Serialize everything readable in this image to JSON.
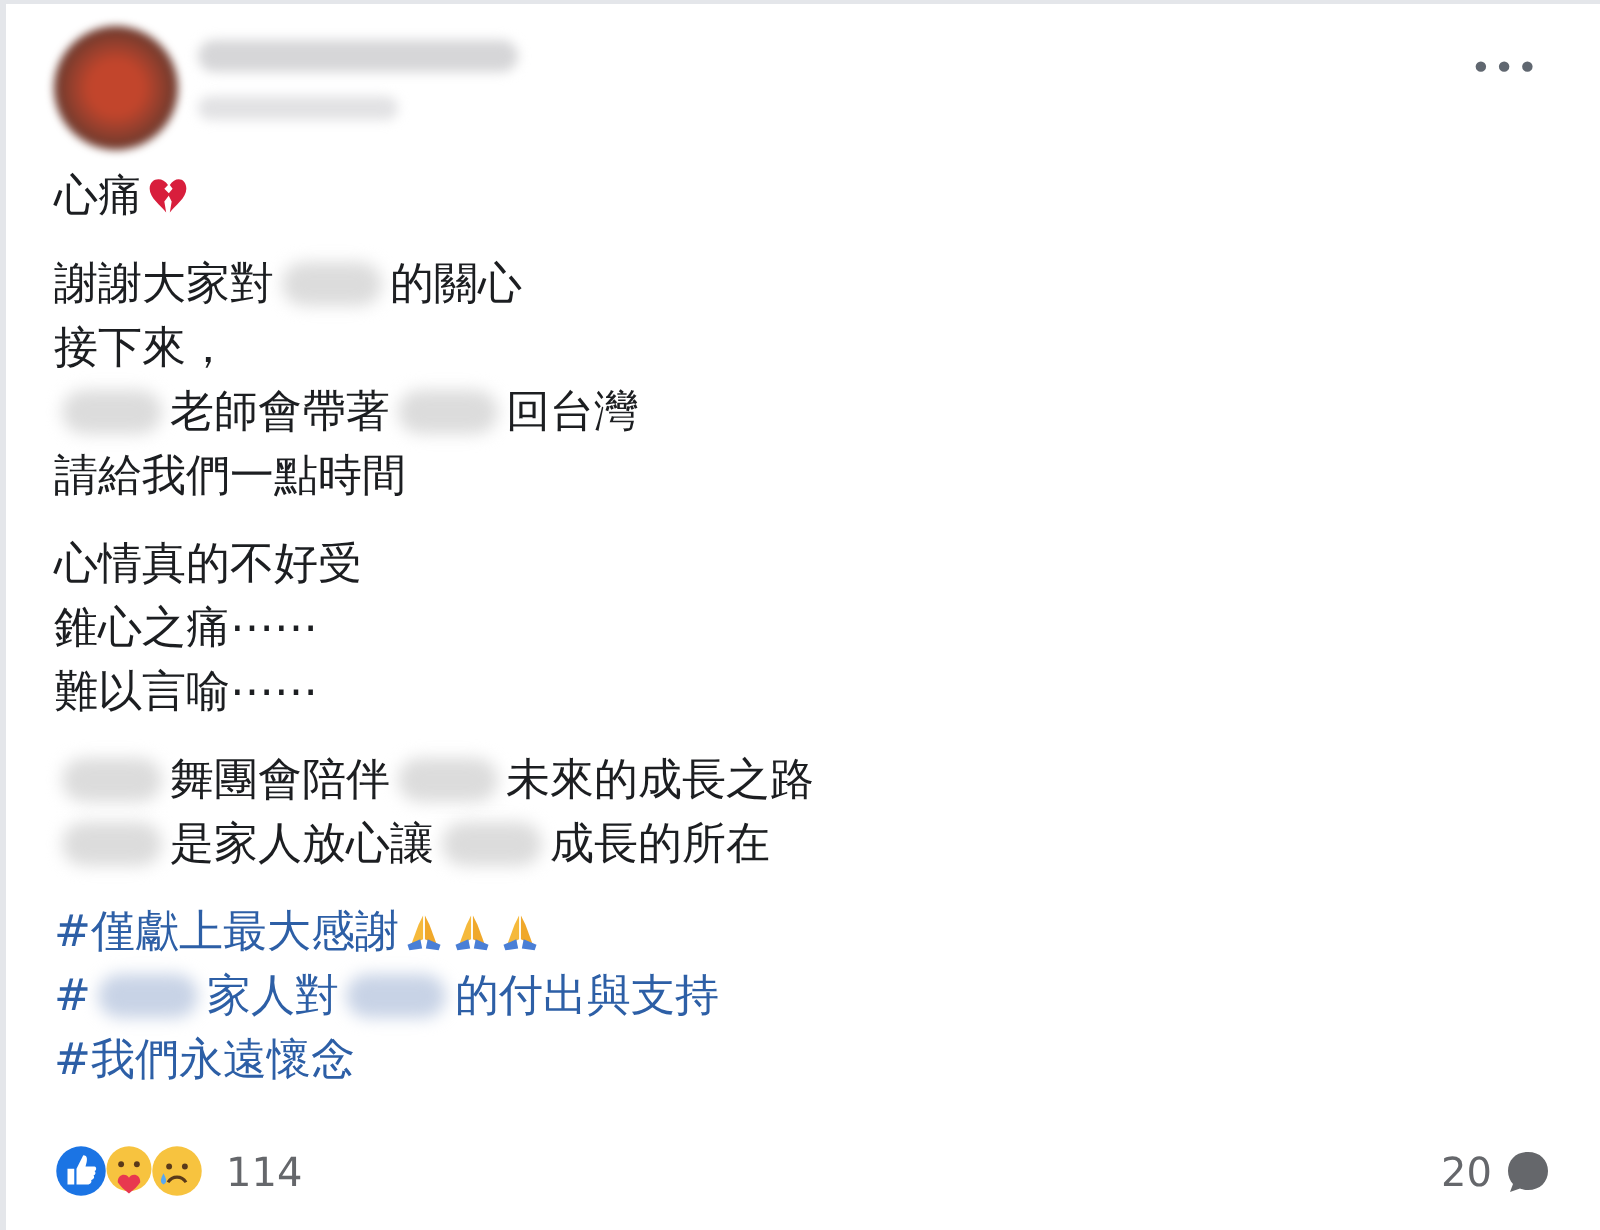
{
  "post": {
    "more_button": "•••",
    "paragraphs": [
      [
        [
          {
            "kind": "text",
            "text": "心痛"
          },
          {
            "kind": "broken-heart"
          }
        ]
      ],
      [
        [
          {
            "kind": "text",
            "text": "謝謝大家對"
          },
          {
            "kind": "blur"
          },
          {
            "kind": "text",
            "text": "的關心"
          }
        ],
        [
          {
            "kind": "text",
            "text": "接下來，"
          }
        ],
        [
          {
            "kind": "blur"
          },
          {
            "kind": "text",
            "text": "老師會帶著"
          },
          {
            "kind": "blur"
          },
          {
            "kind": "text",
            "text": "回台灣"
          }
        ],
        [
          {
            "kind": "text",
            "text": "請給我們一點時間"
          }
        ]
      ],
      [
        [
          {
            "kind": "text",
            "text": "心情真的不好受"
          }
        ],
        [
          {
            "kind": "text",
            "text": "錐心之痛⋯⋯"
          }
        ],
        [
          {
            "kind": "text",
            "text": "難以言喻⋯⋯"
          }
        ]
      ],
      [
        [
          {
            "kind": "blur"
          },
          {
            "kind": "text",
            "text": "舞團會陪伴"
          },
          {
            "kind": "blur"
          },
          {
            "kind": "text",
            "text": "未來的成長之路"
          }
        ],
        [
          {
            "kind": "blur"
          },
          {
            "kind": "text",
            "text": "是家人放心讓"
          },
          {
            "kind": "blur"
          },
          {
            "kind": "text",
            "text": "成長的所在"
          }
        ]
      ]
    ],
    "hashtags": [
      [
        {
          "kind": "text",
          "text": "#僅獻上最大感謝"
        },
        {
          "kind": "praying-hands"
        },
        {
          "kind": "praying-hands"
        },
        {
          "kind": "praying-hands"
        }
      ],
      [
        {
          "kind": "text",
          "text": "#"
        },
        {
          "kind": "blur"
        },
        {
          "kind": "text",
          "text": "家人對"
        },
        {
          "kind": "blur"
        },
        {
          "kind": "text",
          "text": "的付出與支持"
        }
      ],
      [
        {
          "kind": "text",
          "text": "#我們永遠懷念"
        }
      ]
    ],
    "reactions": {
      "count": "114"
    },
    "comments": {
      "count": "20"
    }
  }
}
